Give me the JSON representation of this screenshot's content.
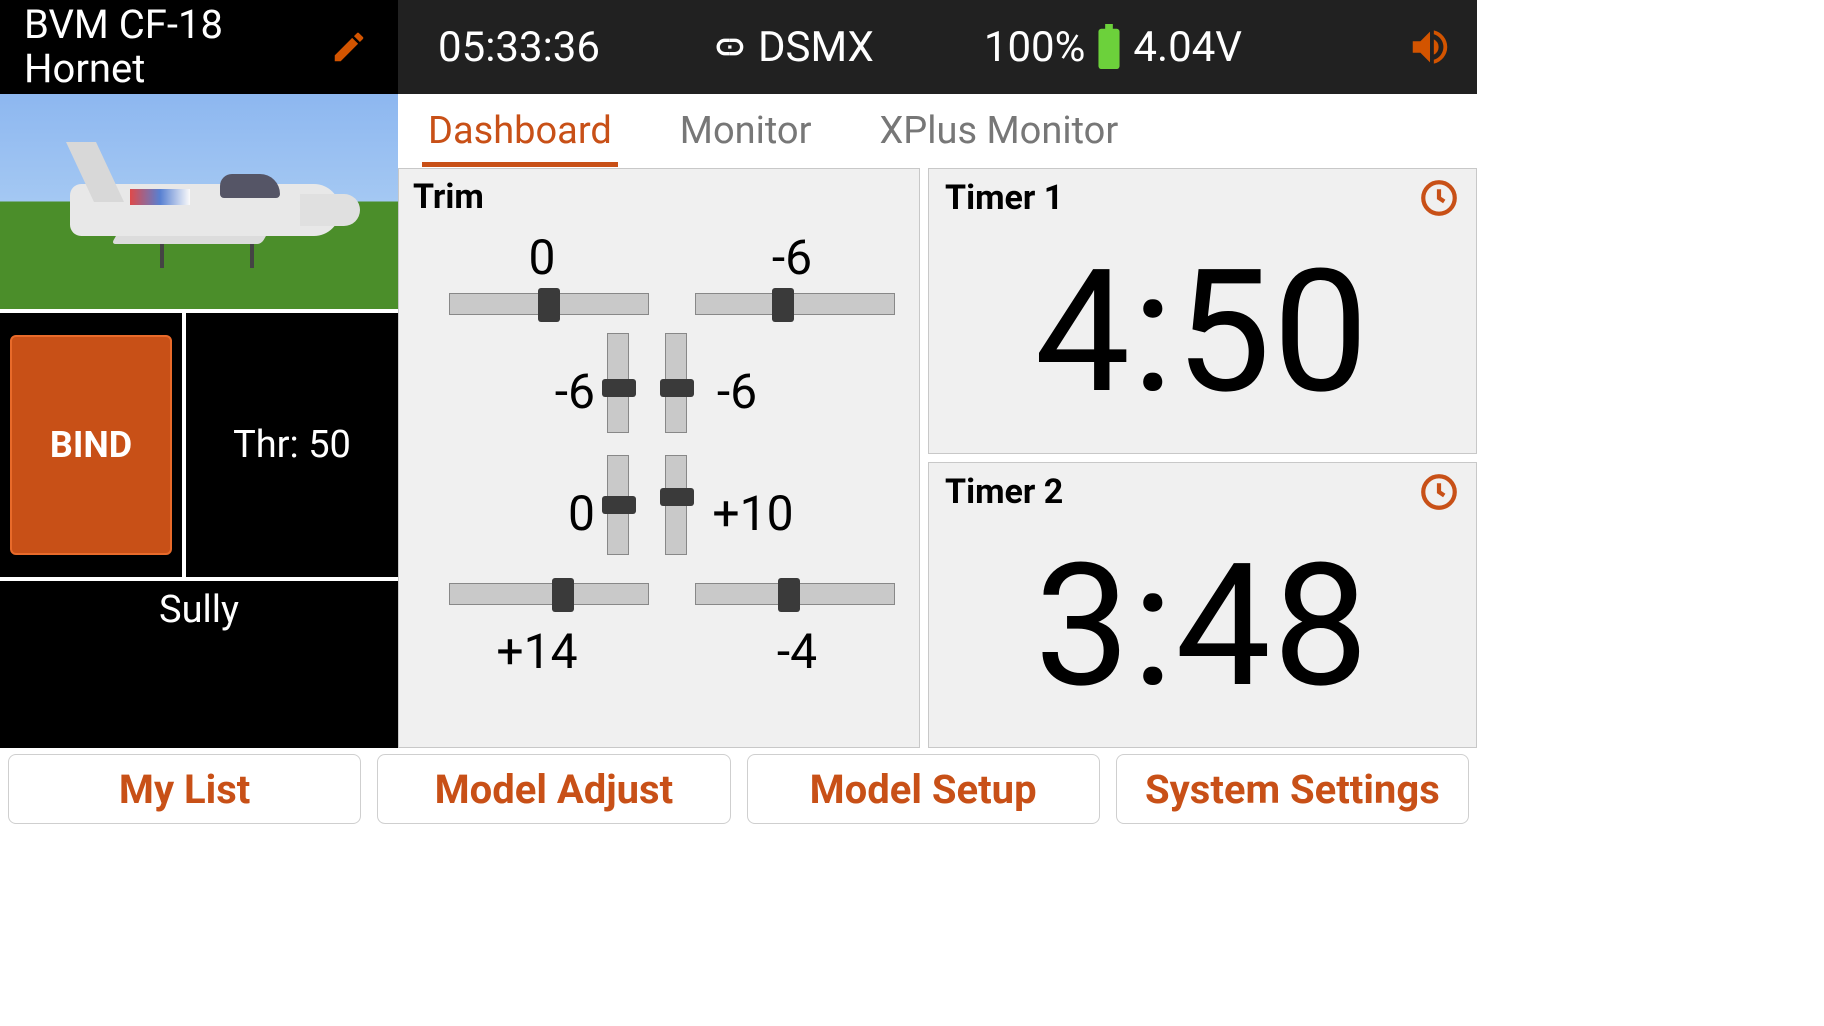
{
  "header": {
    "model_name": "BVM CF-18\nHornet",
    "time": "05:33:36",
    "protocol": "DSMX",
    "battery_pct": "100%",
    "battery_v": "4.04V"
  },
  "sidebar": {
    "bind_label": "BIND",
    "throttle_label": "Thr: 50",
    "pilot_name": "Sully"
  },
  "tabs": [
    {
      "label": "Dashboard",
      "active": true
    },
    {
      "label": "Monitor",
      "active": false
    },
    {
      "label": "XPlus Monitor",
      "active": false
    }
  ],
  "trim": {
    "title": "Trim",
    "top_left": "0",
    "top_right": "-6",
    "mid_upper_left": "-6",
    "mid_upper_right": "-6",
    "mid_lower_left": "0",
    "mid_lower_right": "+10",
    "bottom_left": "+14",
    "bottom_right": "-4"
  },
  "timers": [
    {
      "name": "Timer 1",
      "value": "4:50"
    },
    {
      "name": "Timer 2",
      "value": "3:48"
    }
  ],
  "footer": [
    "My List",
    "Model Adjust",
    "Model Setup",
    "System Settings"
  ],
  "icons": {
    "pencil": "pencil-icon",
    "link": "link-icon",
    "battery": "battery-icon",
    "speaker": "speaker-icon",
    "clock": "clock-icon"
  },
  "colors": {
    "accent": "#c85017",
    "panel_bg": "#f0f0f0",
    "topbar_bg": "#212121"
  }
}
